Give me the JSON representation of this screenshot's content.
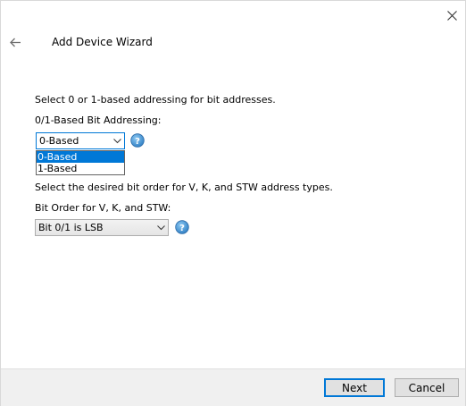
{
  "window": {
    "title": "Add Device Wizard"
  },
  "content": {
    "addressing_instruction": "Select 0 or 1-based addressing for bit addresses.",
    "addressing_label": "0/1-Based Bit Addressing:",
    "addressing_value": "0-Based",
    "addressing_options": [
      "0-Based",
      "1-Based"
    ],
    "bit_order_instruction": "Select the desired bit order for V, K, and STW address types.",
    "bit_order_label": "Bit Order for V, K, and STW:",
    "bit_order_value": "Bit 0/1 is LSB"
  },
  "footer": {
    "next_label": "Next",
    "cancel_label": "Cancel"
  },
  "icons": {
    "close": "close-icon",
    "back": "back-arrow-icon",
    "help": "help-icon",
    "dropdown": "chevron-down-icon"
  },
  "colors": {
    "accent": "#0078d7",
    "help_icon": "#2f8fd5"
  }
}
